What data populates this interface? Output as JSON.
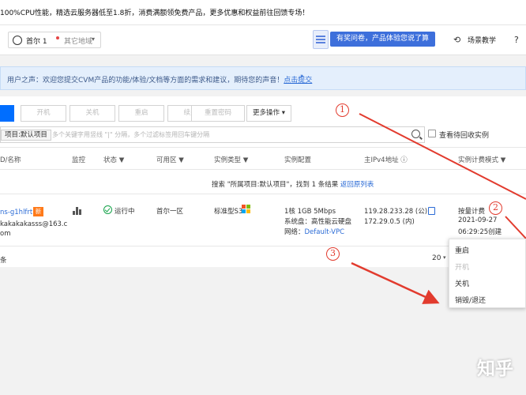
{
  "banner": {
    "text": "100%CPU性能，精选云服务器低至1.8折，消费满额领免费产品，更多优惠和权益前往回馈专场！"
  },
  "toolbar": {
    "region_name": "首尔 1",
    "region_other": "其它地域",
    "feedback_label": "有奖问卷，产品体验您说了算",
    "scene_label": "场景教学"
  },
  "notice": {
    "text": "用户之声：欢迎您提交CVM产品的功能/体验/文档等方面的需求和建议，期待您的声音！",
    "link": "点击提交"
  },
  "actions": {
    "start": "开机",
    "stop": "关机",
    "restart": "重启",
    "renew": "续费",
    "reset_password": "重置密码",
    "more": "更多操作"
  },
  "search": {
    "tag": "项目:默认项目",
    "placeholder": "多个关键字用竖线 \"|\" 分隔，多个过滤标签用回车键分隔"
  },
  "recycle_label": "查看待回收实例",
  "table": {
    "headers": {
      "id": "D/名称",
      "monitor": "监控",
      "status": "状态",
      "zone": "可用区",
      "type": "实例类型",
      "config": "实例配置",
      "ip": "主IPv4地址",
      "billing": "实例计费模式"
    },
    "result": {
      "text": "搜索 \"所属项目:默认项目\"，找到 1 条结果",
      "link": "返回原列表"
    },
    "row": {
      "name_link": "ns-g1hlfrth",
      "new_badge": "新",
      "name_line1": "kakakakasss@163.c",
      "name_line2": "om",
      "status": "运行中",
      "zone": "首尔一区",
      "type": "标准型S3",
      "config_line1": "1核 1GB 5Mbps",
      "config_line2": "系统盘：高性能云硬盘",
      "network_label": "网络：",
      "network_value": "Default-VPC",
      "ip_public": "119.28.233.28 (公)",
      "ip_private": "172.29.0.5 (内)",
      "billing_mode": "按量计费",
      "billing_date": "2021-09-27",
      "billing_time": "06:29:25创建"
    }
  },
  "pagination": {
    "suffix": "条",
    "page_size": "20"
  },
  "menu": {
    "restart": "重启",
    "start": "开机",
    "stop": "关机",
    "destroy": "销毁/退还"
  },
  "annotations": {
    "one": "1",
    "two": "2",
    "three": "3"
  },
  "watermark": "知乎",
  "colors": {
    "primary": "#006eff",
    "link": "#2b6bd6",
    "annotation": "#e23b2e",
    "running": "#16a34a",
    "new_badge": "#ff7a1a"
  }
}
